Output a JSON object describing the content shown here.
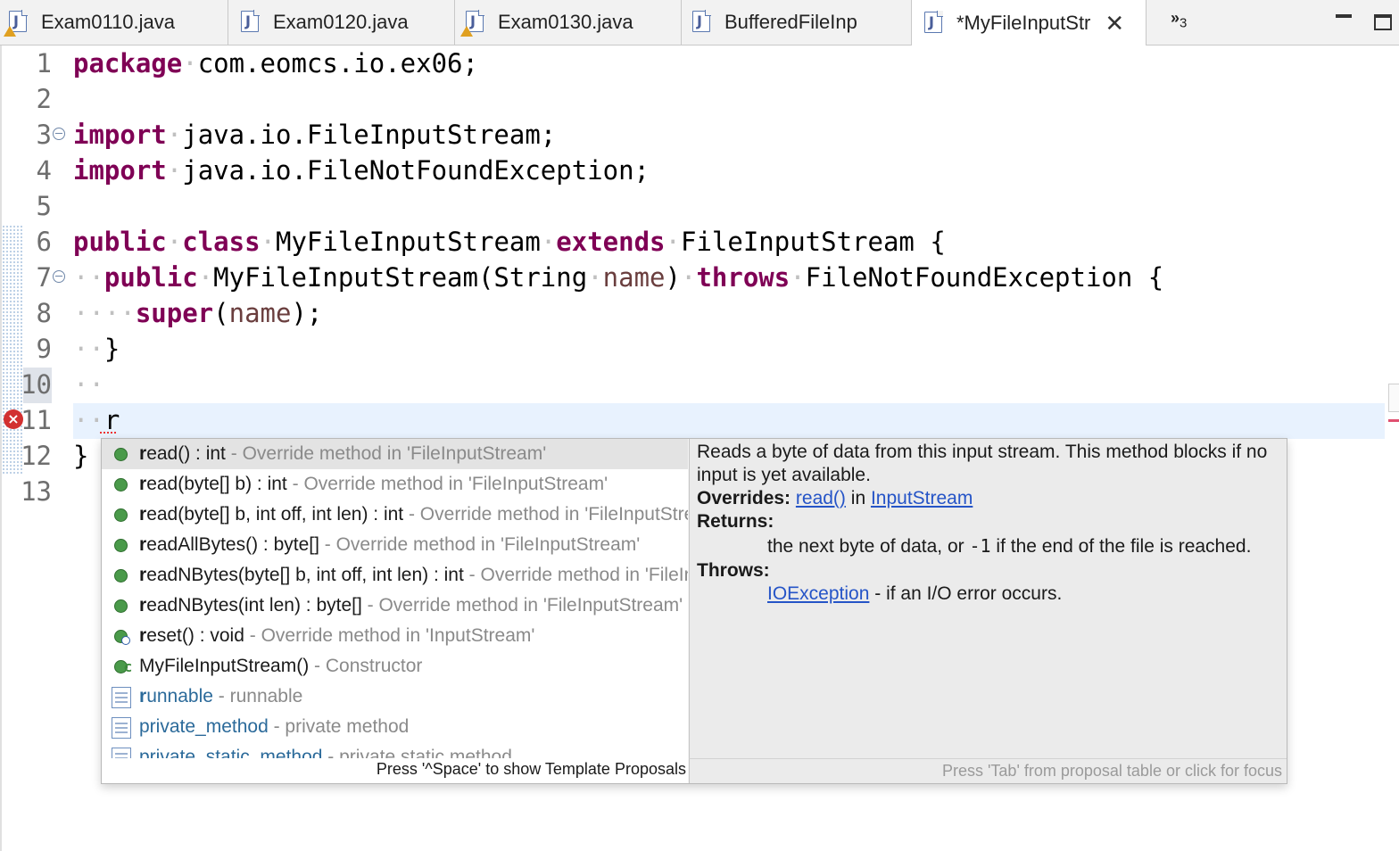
{
  "tabs": [
    {
      "label": "Exam0110.java",
      "warning": true
    },
    {
      "label": "Exam0120.java",
      "warning": false
    },
    {
      "label": "Exam0130.java",
      "warning": true
    },
    {
      "label": "BufferedFileInp",
      "warning": false
    },
    {
      "label": "*MyFileInputStr",
      "warning": false,
      "active": true
    }
  ],
  "overflow": {
    "symbol": "»",
    "count": "3"
  },
  "editor": {
    "line_numbers": [
      "1",
      "2",
      "3",
      "4",
      "5",
      "6",
      "7",
      "8",
      "9",
      "10",
      "11",
      "12",
      "13"
    ],
    "lines": {
      "l1_kw": "package",
      "l1_rest": "com.eomcs.io.ex06;",
      "l3_kw": "import",
      "l3_rest": "java.io.FileInputStream;",
      "l4_kw": "import",
      "l4_rest": "java.io.FileNotFoundException;",
      "l6_kw1": "public",
      "l6_kw2": "class",
      "l6_name": "MyFileInputStream",
      "l6_kw3": "extends",
      "l6_rest": "FileInputStream {",
      "l7_kw1": "public",
      "l7_sig": "MyFileInputStream(String",
      "l7_param": "name",
      "l7_close": ")",
      "l7_kw2": "throws",
      "l7_rest": "FileNotFoundException {",
      "l8_kw": "super",
      "l8_open": "(",
      "l8_param": "name",
      "l8_close": ");",
      "l9_text": "}",
      "l11_text": "r",
      "l12_text": "}"
    },
    "error_marker": "×"
  },
  "proposals": {
    "items": [
      {
        "bold": "r",
        "text": "ead() : int",
        "desc": " - Override method in 'FileInputStream'",
        "icon": "method-icon"
      },
      {
        "bold": "r",
        "text": "ead(byte[] b) : int",
        "desc": " - Override method in 'FileInputStream'",
        "icon": "method-icon"
      },
      {
        "bold": "r",
        "text": "ead(byte[] b, int off, int len) : int",
        "desc": " - Override method in 'FileInputStream'",
        "icon": "method-icon"
      },
      {
        "bold": "r",
        "text": "eadAllBytes() : byte[]",
        "desc": " - Override method in 'FileInputStream'",
        "icon": "method-icon"
      },
      {
        "bold": "r",
        "text": "eadNBytes(byte[] b, int off, int len) : int",
        "desc": " - Override method in 'FileInputStream'",
        "icon": "method-icon"
      },
      {
        "bold": "r",
        "text": "eadNBytes(int len) : byte[]",
        "desc": " - Override method in 'FileInputStream'",
        "icon": "method-icon"
      },
      {
        "bold": "r",
        "text": "eset() : void",
        "desc": " - Override method in 'InputStream'",
        "icon": "method-synchronized-icon"
      },
      {
        "bold": "",
        "text": "MyFileInputStream() ",
        "desc": "- Constructor",
        "icon": "constructor-icon"
      },
      {
        "bold": "r",
        "text": "unnable",
        "desc": " - runnable",
        "icon": "template-icon"
      },
      {
        "bold": "",
        "text": "private_method",
        "desc": " - private method",
        "icon": "template-icon"
      },
      {
        "bold": "",
        "text": "private_static_method",
        "desc": " - private static method",
        "icon": "template-icon"
      }
    ],
    "hint": "Press '^Space' to show Template Proposals"
  },
  "doc": {
    "summary": "Reads a byte of data from this input stream. This method blocks if no input is yet available.",
    "overrides_label": "Overrides:",
    "overrides_link": "read()",
    "overrides_in": " in ",
    "overrides_class": "InputStream",
    "returns_label": "Returns:",
    "returns_pre": "the next byte of data, or ",
    "returns_code": "-1",
    "returns_post": " if the end of the file is reached.",
    "throws_label": "Throws:",
    "throws_link": "IOException",
    "throws_text": " - if an I/O error occurs.",
    "footer": "Press 'Tab' from proposal table or click for focus"
  }
}
